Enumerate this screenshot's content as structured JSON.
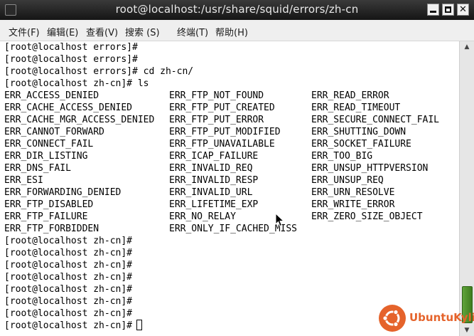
{
  "window": {
    "title": "root@localhost:/usr/share/squid/errors/zh-cn"
  },
  "menubar": {
    "items": [
      {
        "label": "文件(F)"
      },
      {
        "label": "编辑(E)"
      },
      {
        "label": "查看(V)"
      },
      {
        "label": "搜索 (S)"
      },
      {
        "label": "终端(T)"
      },
      {
        "label": "帮助(H)"
      }
    ]
  },
  "terminal": {
    "lines_before": [
      "[root@localhost errors]#",
      "[root@localhost errors]#",
      "[root@localhost errors]# cd zh-cn/",
      "[root@localhost zh-cn]# ls"
    ],
    "ls_columns": [
      [
        "ERR_ACCESS_DENIED",
        "ERR_CACHE_ACCESS_DENIED",
        "ERR_CACHE_MGR_ACCESS_DENIED",
        "ERR_CANNOT_FORWARD",
        "ERR_CONNECT_FAIL",
        "ERR_DIR_LISTING",
        "ERR_DNS_FAIL",
        "ERR_ESI",
        "ERR_FORWARDING_DENIED",
        "ERR_FTP_DISABLED",
        "ERR_FTP_FAILURE",
        "ERR_FTP_FORBIDDEN"
      ],
      [
        "ERR_FTP_NOT_FOUND",
        "ERR_FTP_PUT_CREATED",
        "ERR_FTP_PUT_ERROR",
        "ERR_FTP_PUT_MODIFIED",
        "ERR_FTP_UNAVAILABLE",
        "ERR_ICAP_FAILURE",
        "ERR_INVALID_REQ",
        "ERR_INVALID_RESP",
        "ERR_INVALID_URL",
        "ERR_LIFETIME_EXP",
        "ERR_NO_RELAY",
        "ERR_ONLY_IF_CACHED_MISS"
      ],
      [
        "ERR_READ_ERROR",
        "ERR_READ_TIMEOUT",
        "ERR_SECURE_CONNECT_FAIL",
        "ERR_SHUTTING_DOWN",
        "ERR_SOCKET_FAILURE",
        "ERR_TOO_BIG",
        "ERR_UNSUP_HTTPVERSION",
        "ERR_UNSUP_REQ",
        "ERR_URN_RESOLVE",
        "ERR_WRITE_ERROR",
        "ERR_ZERO_SIZE_OBJECT"
      ]
    ],
    "lines_after": [
      "[root@localhost zh-cn]#",
      "[root@localhost zh-cn]#",
      "[root@localhost zh-cn]#",
      "[root@localhost zh-cn]#",
      "[root@localhost zh-cn]#",
      "[root@localhost zh-cn]#",
      "[root@localhost zh-cn]#",
      "[root@localhost zh-cn]#"
    ]
  },
  "logo": {
    "text": "UbuntuKylin"
  },
  "colors": {
    "titlebar": "#1e1e1e",
    "scroll_thumb": "#4f8f2a",
    "logo": "#e5632b"
  }
}
